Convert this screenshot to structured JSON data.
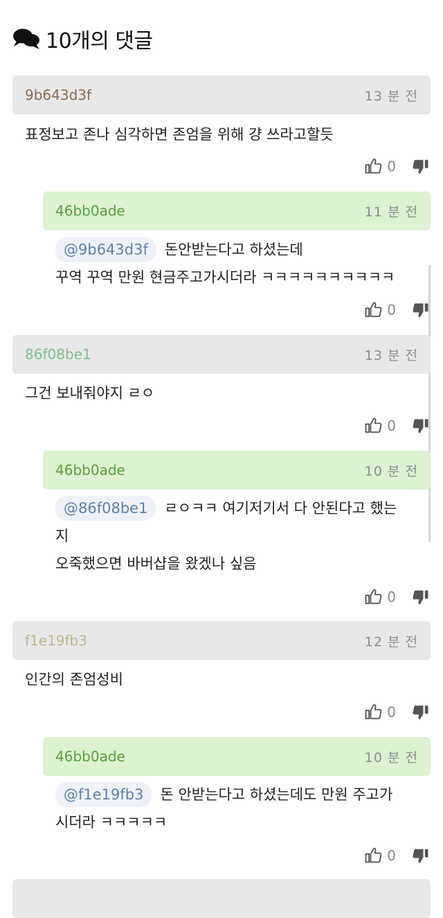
{
  "header": {
    "icon": "comments-icon",
    "title": "10개의 댓글"
  },
  "comments": [
    {
      "author": "9b643d3f",
      "author_color": "#8c6a4e",
      "time": "13 분 전",
      "text": "표정보고 존나 심각하면 존엄을 위해 걍 쓰라고할듯",
      "likes": "0",
      "reply": {
        "author": "46bb0ade",
        "author_color": "#5aa03a",
        "time": "11 분 전",
        "mention": "@9b643d3f",
        "line1": "돈안받는다고 하셨는데",
        "line2": "꾸역 꾸역 만원 현금주고가시더라 ㅋㅋㅋㅋㅋㅋㅋㅋㅋㅋ",
        "likes": "0"
      }
    },
    {
      "author": "86f08be1",
      "author_color": "#7fbf8e",
      "time": "13 분 전",
      "text": "그건 보내줘야지 ㄹㅇ",
      "likes": "0",
      "reply": {
        "author": "46bb0ade",
        "author_color": "#5aa03a",
        "time": "10 분 전",
        "mention": "@86f08be1",
        "line1": "ㄹㅇㅋㅋ 여기저기서 다 안된다고 했는",
        "line2": "지",
        "line3": "오죽했으면 바버샵을 왔겠나 싶음",
        "likes": "0"
      }
    },
    {
      "author": "f1e19fb3",
      "author_color": "#c0b98a",
      "time": "12 분 전",
      "text": "인간의 존엄성비",
      "likes": "0",
      "reply": {
        "author": "46bb0ade",
        "author_color": "#5aa03a",
        "time": "10 분 전",
        "mention": "@f1e19fb3",
        "line1": "돈 안받는다고 하셨는데도 만원 주고가",
        "line2": "시더라 ㅋㅋㅋㅋㅋ",
        "likes": "0"
      }
    }
  ]
}
